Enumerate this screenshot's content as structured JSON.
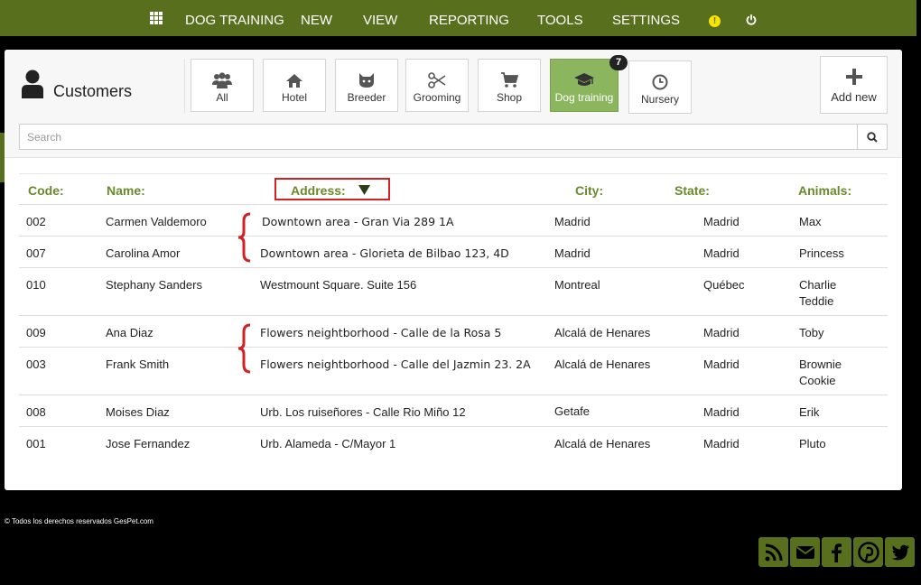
{
  "nav": {
    "items": [
      "DOG TRAINING",
      "NEW",
      "VIEW",
      "REPORTING",
      "TOOLS",
      "SETTINGS"
    ]
  },
  "header": {
    "title": "Customers",
    "categories": [
      {
        "label": "All",
        "icon": "users-icon"
      },
      {
        "label": "Hotel",
        "icon": "home-icon"
      },
      {
        "label": "Breeder",
        "icon": "breeder-icon"
      },
      {
        "label": "Grooming",
        "icon": "scissors-icon"
      },
      {
        "label": "Shop",
        "icon": "cart-icon"
      },
      {
        "label": "Dog training",
        "icon": "graduation-cap-icon",
        "active": true,
        "badge": "7"
      },
      {
        "label": "Nursery",
        "icon": "clock-icon"
      }
    ],
    "add_new": "Add new"
  },
  "search": {
    "placeholder": "Search"
  },
  "table": {
    "columns": [
      "Code:",
      "Name:",
      "Address:",
      "City:",
      "State:",
      "Animals:"
    ],
    "rows": [
      {
        "code": "002",
        "name": "Carmen Valdemoro",
        "address": "Downtown area - Gran Via 289 1A",
        "city": "Madrid",
        "state": "Madrid",
        "animals": [
          "Max"
        ]
      },
      {
        "code": "007",
        "name": "Carolina Amor",
        "address": "Downtown area - Glorieta de Bilbao 123, 4D",
        "city": "Madrid",
        "state": "Madrid",
        "animals": [
          "Princess"
        ]
      },
      {
        "code": "010",
        "name": "Stephany Sanders",
        "address": "Westmount Square. Suite 156",
        "city": "Montreal",
        "state": "Québec",
        "animals": [
          "Charlie",
          "Teddie"
        ]
      },
      {
        "code": "009",
        "name": "Ana Diaz",
        "address": "Flowers neightborhood - Calle de la Rosa 5",
        "city": "Alcalá de Henares",
        "state": "Madrid",
        "animals": [
          "Toby"
        ]
      },
      {
        "code": "003",
        "name": "Frank Smith",
        "address": "Flowers neightborhood - Calle del Jazmin 23. 2A",
        "city": "Alcalá de Henares",
        "state": "Madrid",
        "animals": [
          "Brownie",
          "Cookie"
        ]
      },
      {
        "code": "008",
        "name": "Moises Diaz",
        "address": "Urb. Los ruiseñores - Calle Rio Miño 12",
        "city": "Getafe",
        "state": "Madrid",
        "animals": [
          "Erik"
        ]
      },
      {
        "code": "001",
        "name": "Jose Fernandez",
        "address": "Urb. Alameda - C/Mayor 1",
        "city": "Alcalá de Henares",
        "state": "Madrid",
        "animals": [
          "Pluto"
        ]
      }
    ]
  },
  "footer": {
    "copyright": "©   Todos los derechos reservados GesPet.com"
  },
  "colors": {
    "brand_green": "#58701e",
    "active_tab": "#8cb65d",
    "highlight_red": "#d32020"
  }
}
